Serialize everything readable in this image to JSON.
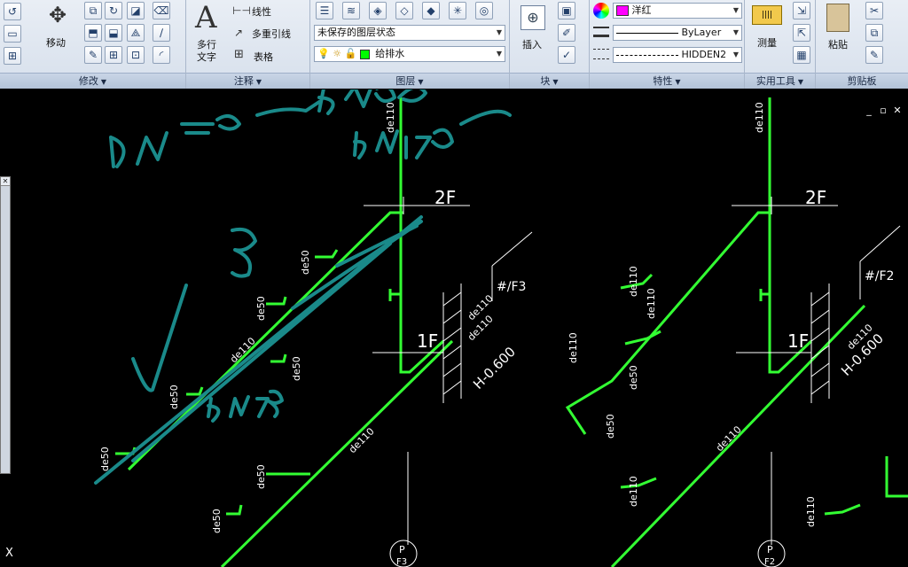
{
  "ribbon": {
    "modify": {
      "title": "修改",
      "move_label": "移动"
    },
    "annotation": {
      "title": "注释",
      "mtext_label": "多行文字",
      "mtext_line1": "多行",
      "mtext_line2": "文字",
      "linear_label": "线性",
      "mleader_label": "多重引线",
      "table_label": "表格"
    },
    "layers": {
      "title": "图层",
      "layer_state": "未保存的图层状态",
      "current_layer": "给排水"
    },
    "block": {
      "title": "块",
      "insert_label": "插入"
    },
    "properties": {
      "title": "特性",
      "color_value": "洋红",
      "color_swatch": "#ff00ff",
      "lineweight_value": "ByLayer",
      "linetype_value": "HIDDEN2"
    },
    "utilities": {
      "title": "实用工具",
      "measure_label": "测量"
    },
    "clipboard": {
      "title": "剪贴板",
      "paste_label": "粘贴"
    }
  },
  "drawing": {
    "floor_2f": "2F",
    "floor_1f": "1F",
    "pipe_de110": "de110",
    "pipe_de50": "de50",
    "elevation": "H-0.600",
    "tag_f3": "#/F3",
    "tag_f2": "#/F2",
    "symbol_p": "P",
    "symbol_f3": "F3",
    "symbol_f2": "F2",
    "pipe_color": "#33ff33",
    "annotation_color": "#1a8a8a"
  },
  "ucs_label": "X",
  "window_controls": [
    "_",
    "▫",
    "✕"
  ]
}
